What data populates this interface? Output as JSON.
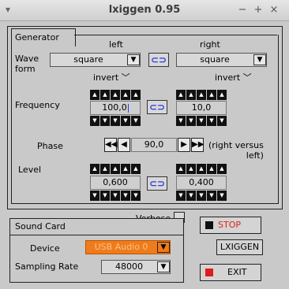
{
  "window": {
    "title": "lxiggen 0.95",
    "minimize": "−",
    "maximize": "+",
    "close": "×"
  },
  "generator": {
    "tab": "Generator",
    "left_label": "left",
    "right_label": "right",
    "waveform_label": "Wave\nform",
    "waveform_left": "square",
    "waveform_right": "square",
    "invert_left": "invert",
    "invert_right": "invert",
    "frequency_label": "Frequency",
    "freq_left": "100,0",
    "freq_right": "10,0",
    "phase_label": "Phase",
    "phase_value": "90,0",
    "phase_note": "(right versus\nleft)",
    "level_label": "Level",
    "level_left": "0,600",
    "level_right": "0,400"
  },
  "verbose": {
    "label": "Verbose",
    "checked": false
  },
  "sound": {
    "title": "Sound Card",
    "device_label": "Device",
    "device_value": "USB Audio 0",
    "rate_label": "Sampling Rate",
    "rate_value": "48000"
  },
  "buttons": {
    "stop": "STOP",
    "lxiggen": "LXIGGEN",
    "exit": "EXIT"
  },
  "icons": {
    "link": "link-chain-icon",
    "dropdown": "arrow-down-icon",
    "chevron": "chevron-down-icon"
  },
  "colors": {
    "accent": "#2a3ce0",
    "stop_text": "#e0221b",
    "device_bg": "#f07b1c",
    "exit_indicator": "#e01b1b"
  }
}
